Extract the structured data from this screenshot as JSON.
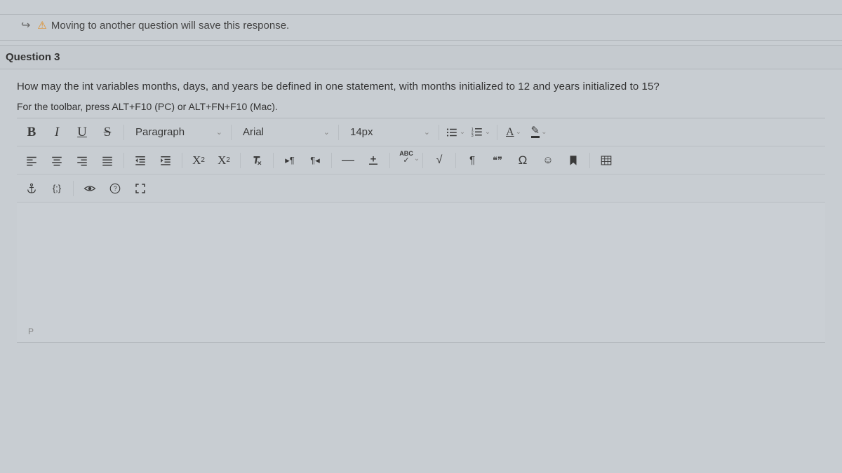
{
  "warning": {
    "text": "Moving to another question will save this response."
  },
  "question": {
    "title": "Question 3",
    "text": "How may the int variables months, days, and years be defined in one statement, with months initialized to 12 and years initialized to 15?",
    "hint": "For the toolbar, press ALT+F10 (PC) or ALT+FN+F10 (Mac)."
  },
  "toolbar": {
    "bold": "B",
    "italic": "I",
    "underline": "U",
    "strike": "S",
    "paragraph": "Paragraph",
    "font": "Arial",
    "size": "14px",
    "ul_label": "≡",
    "ol_label": "≡",
    "fontcolor": "A",
    "highlight": "✎",
    "abc": "ABC",
    "check": "✓",
    "para": "¶",
    "quote": "❝❞",
    "omega": "Ω",
    "smile": "☺",
    "bookmark": "🔖",
    "table": "▦",
    "anchor": "⚓",
    "braces": "{;}",
    "eye": "◉",
    "help": "?",
    "fullscreen": "⛶"
  },
  "editor": {
    "path": "P"
  }
}
